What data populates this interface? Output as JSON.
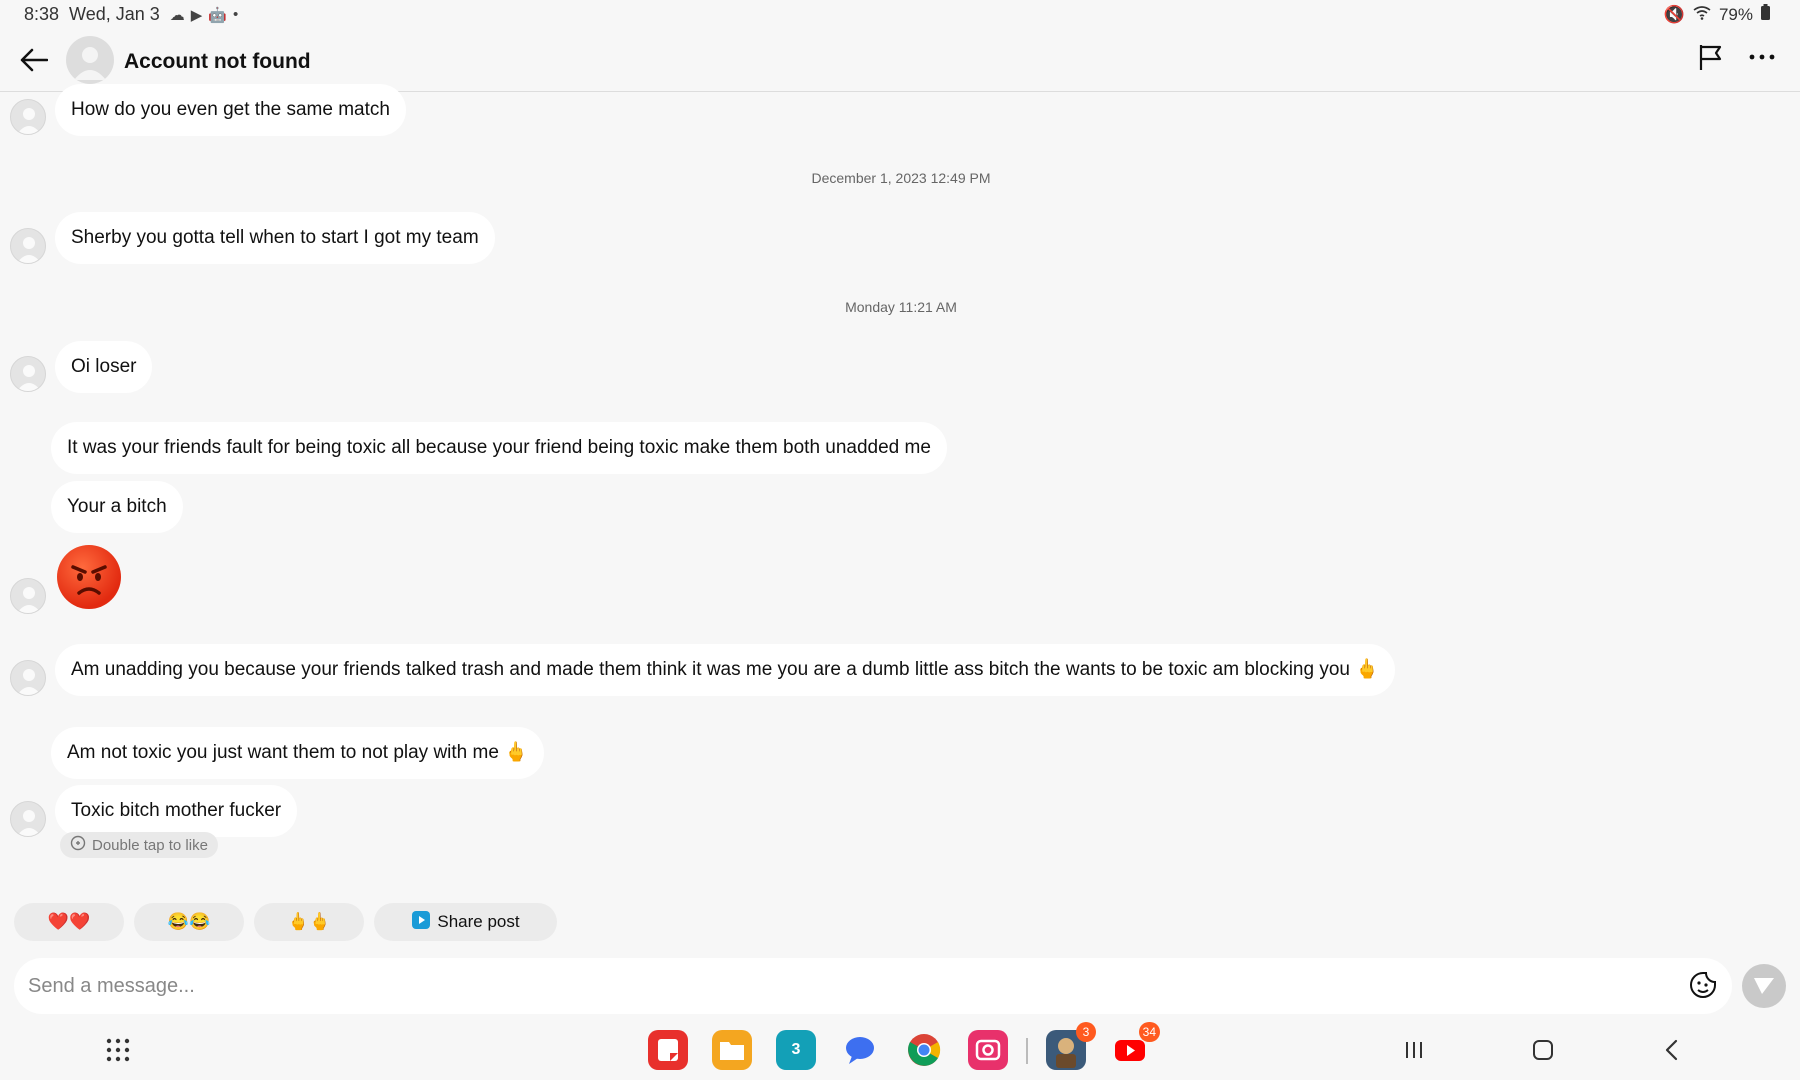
{
  "status_bar": {
    "time": "8:38",
    "date": "Wed, Jan 3",
    "battery": "79%"
  },
  "header": {
    "title": "Account not found"
  },
  "messages": [
    {
      "text": "How do you even get the same match"
    },
    {
      "timestamp": "December 1, 2023 12:49 PM"
    },
    {
      "text": "Sherby you gotta tell when to start I got my team"
    },
    {
      "timestamp": "Monday 11:21 AM"
    },
    {
      "text": "Oi loser"
    },
    {
      "text": "It was your friends fault for being toxic all because your friend being toxic make them both unadded me"
    },
    {
      "text": "Your a bitch"
    },
    {
      "emoji": "😡"
    },
    {
      "text": "Am unadding you because  your friends talked trash and made them think it was me you are a dumb little ass bitch the wants to be toxic am blocking you 🖕"
    },
    {
      "text": "Am not toxic you just want them to not play with me 🖕"
    },
    {
      "text": "Toxic bitch mother fucker"
    }
  ],
  "like_hint": "Double tap to like",
  "quick_replies": [
    "❤️❤️",
    "😂😂",
    "🖕🖕",
    "Share post"
  ],
  "composer": {
    "placeholder": "Send a message..."
  },
  "dock": {
    "badges": {
      "pubg": "3",
      "youtube": "34"
    },
    "calendar_day": "3"
  }
}
